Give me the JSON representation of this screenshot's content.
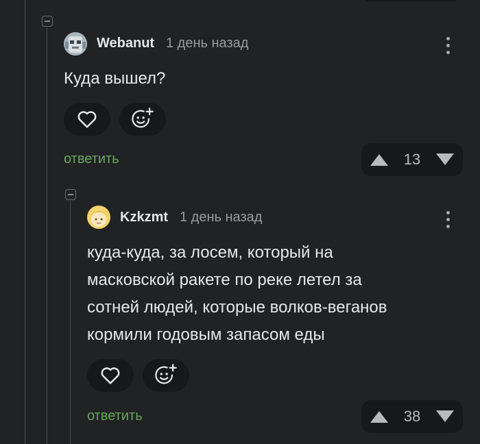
{
  "comments": [
    {
      "username": "Webanut",
      "time": "1 день назад",
      "text": [
        "Куда вышел?"
      ],
      "reply_label": "ответить",
      "rating": "13",
      "avatar_icon": "robot-avatar-icon"
    },
    {
      "username": "Kzkzmt",
      "time": "1 день назад",
      "text": [
        "куда-куда, за лосем, который на",
        "масковской ракете по реке летел за",
        "сотней людей, которые волков-веганов",
        "кормили годовым запасом еды"
      ],
      "reply_label": "ответить",
      "rating": "38",
      "avatar_icon": "cartoon-face-avatar-icon"
    }
  ],
  "colors": {
    "background": "#212224",
    "pill": "#17181a",
    "reply": "#65a85a",
    "muted": "#9a9ba0"
  }
}
